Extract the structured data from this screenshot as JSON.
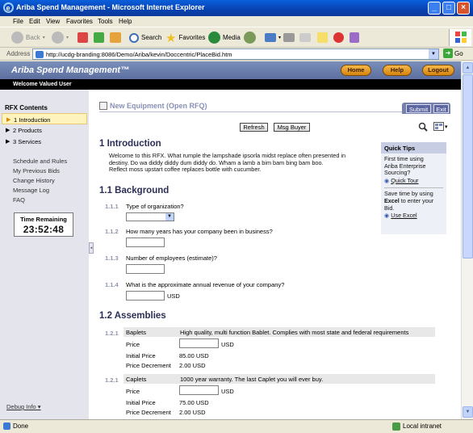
{
  "window": {
    "title": "Ariba Spend Management - Microsoft Internet Explorer",
    "minimize": "_",
    "maximize": "□",
    "close": "×"
  },
  "menu": [
    "File",
    "Edit",
    "View",
    "Favorites",
    "Tools",
    "Help"
  ],
  "toolbar": {
    "back": "Back",
    "search": "Search",
    "favorites": "Favorites",
    "media": "Media"
  },
  "address": {
    "label": "Address",
    "url": "http://ucdg-branding:8086/Demo/Ariba/kevin/Doccentric/PlaceBid.htm",
    "go": "Go"
  },
  "header": {
    "brand": "Ariba Spend Management™",
    "home": "Home",
    "help": "Help",
    "logout": "Logout",
    "welcome": "Welcome Valued User"
  },
  "sidebar": {
    "heading": "RFX Contents",
    "items": [
      {
        "label": "1 Introduction",
        "active": true
      },
      {
        "label": "2 Products",
        "active": false
      },
      {
        "label": "3 Services",
        "active": false
      }
    ],
    "links": [
      "Schedule and Rules",
      "My Previous Bids",
      "Change History",
      "Message Log",
      "FAQ"
    ],
    "timer_label": "Time Remaining",
    "timer_value": "23:52:48",
    "debug": "Debug Info"
  },
  "doc": {
    "title": "New Equipment (Open RFQ)",
    "submit": "Submit",
    "exit": "Exit",
    "refresh": "Refresh",
    "msg_buyer": "Msg Buyer"
  },
  "intro": {
    "heading": "1  Introduction",
    "line1": "Welcome to this RFX. What rumple the lampshade ipsorla midst replace often presented in",
    "line2": "destiny. Do wa diddy diddy dum diddy do. Wham a lamb a bim bam bing bam boo.",
    "line3": "Reflect moss upstart coffee replaces bottle with cucumber."
  },
  "quick_tips": {
    "title": "Quick Tips",
    "t1a": "First time using",
    "t1b": "Ariba Enterprise",
    "t1c": "Sourcing?",
    "link1": "Quick Tour",
    "t2a": "Save time by using",
    "t2b_bold": "Excel",
    "t2b_rest": " to enter your",
    "t2c": "Bid.",
    "link2": "Use Excel"
  },
  "background": {
    "heading": "1.1  Background",
    "questions": [
      {
        "num": "1.1.1",
        "text": "Type of organization?"
      },
      {
        "num": "1.1.2",
        "text": "How many years has your company been in business?"
      },
      {
        "num": "1.1.3",
        "text": "Number of employees (estimate)?"
      },
      {
        "num": "1.1.4",
        "text": "What is the approximate annual revenue of your company?"
      }
    ],
    "usd": "USD"
  },
  "assemblies": {
    "heading": "1.2  Assemblies",
    "items": [
      {
        "num": "1.2.1",
        "name": "Baplets",
        "desc": "High quality, multi function Bablet. Complies with most state and federal requirements",
        "price_label": "Price",
        "currency": "USD",
        "initial_label": "Initial Price",
        "initial_value": "85.00 USD",
        "decrement_label": "Price Decrement",
        "decrement_value": "2.00 USD"
      },
      {
        "num": "1.2.1",
        "name": "Caplets",
        "desc": "1000 year warranty. The last Caplet you will ever buy.",
        "price_label": "Price",
        "currency": "USD",
        "initial_label": "Initial Price",
        "initial_value": "75.00 USD",
        "decrement_label": "Price Decrement",
        "decrement_value": "2.00 USD"
      }
    ]
  },
  "status": {
    "left": "Done",
    "zone": "Local intranet"
  }
}
